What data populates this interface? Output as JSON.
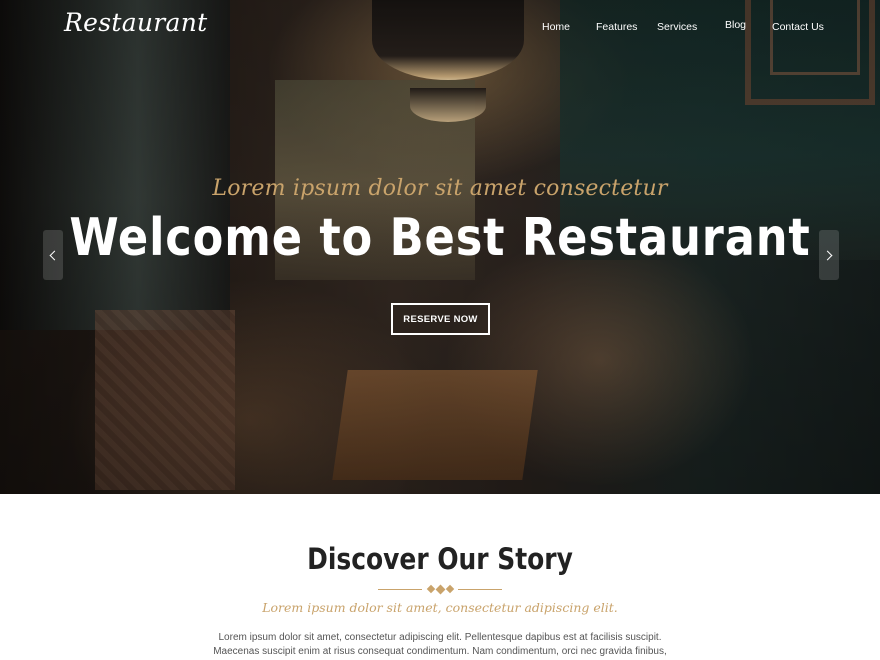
{
  "header": {
    "logo": "Restaurant",
    "nav": [
      {
        "label": "Home"
      },
      {
        "label": "Features"
      },
      {
        "label": "Services"
      },
      {
        "label": "Blog"
      },
      {
        "label": "Contact Us"
      }
    ]
  },
  "hero": {
    "tagline": "Lorem ipsum dolor sit amet consectetur",
    "headline": "Welcome to Best Restaurant",
    "button_label": "RESERVE NOW",
    "prev_icon": "chevron-left-icon",
    "next_icon": "chevron-right-icon"
  },
  "story": {
    "title": "Discover Our Story",
    "tagline": "Lorem ipsum dolor sit amet, consectetur adipiscing elit.",
    "body_line1": "Lorem ipsum dolor sit amet, consectetur adipiscing elit. Pellentesque dapibus est at facilisis suscipit.",
    "body_line2": "Maecenas suscipit enim at risus consequat condimentum. Nam condimentum, orci nec gravida finibus,"
  },
  "colors": {
    "accent": "#c9a36b",
    "heading": "#222222",
    "body_text": "#555555"
  }
}
